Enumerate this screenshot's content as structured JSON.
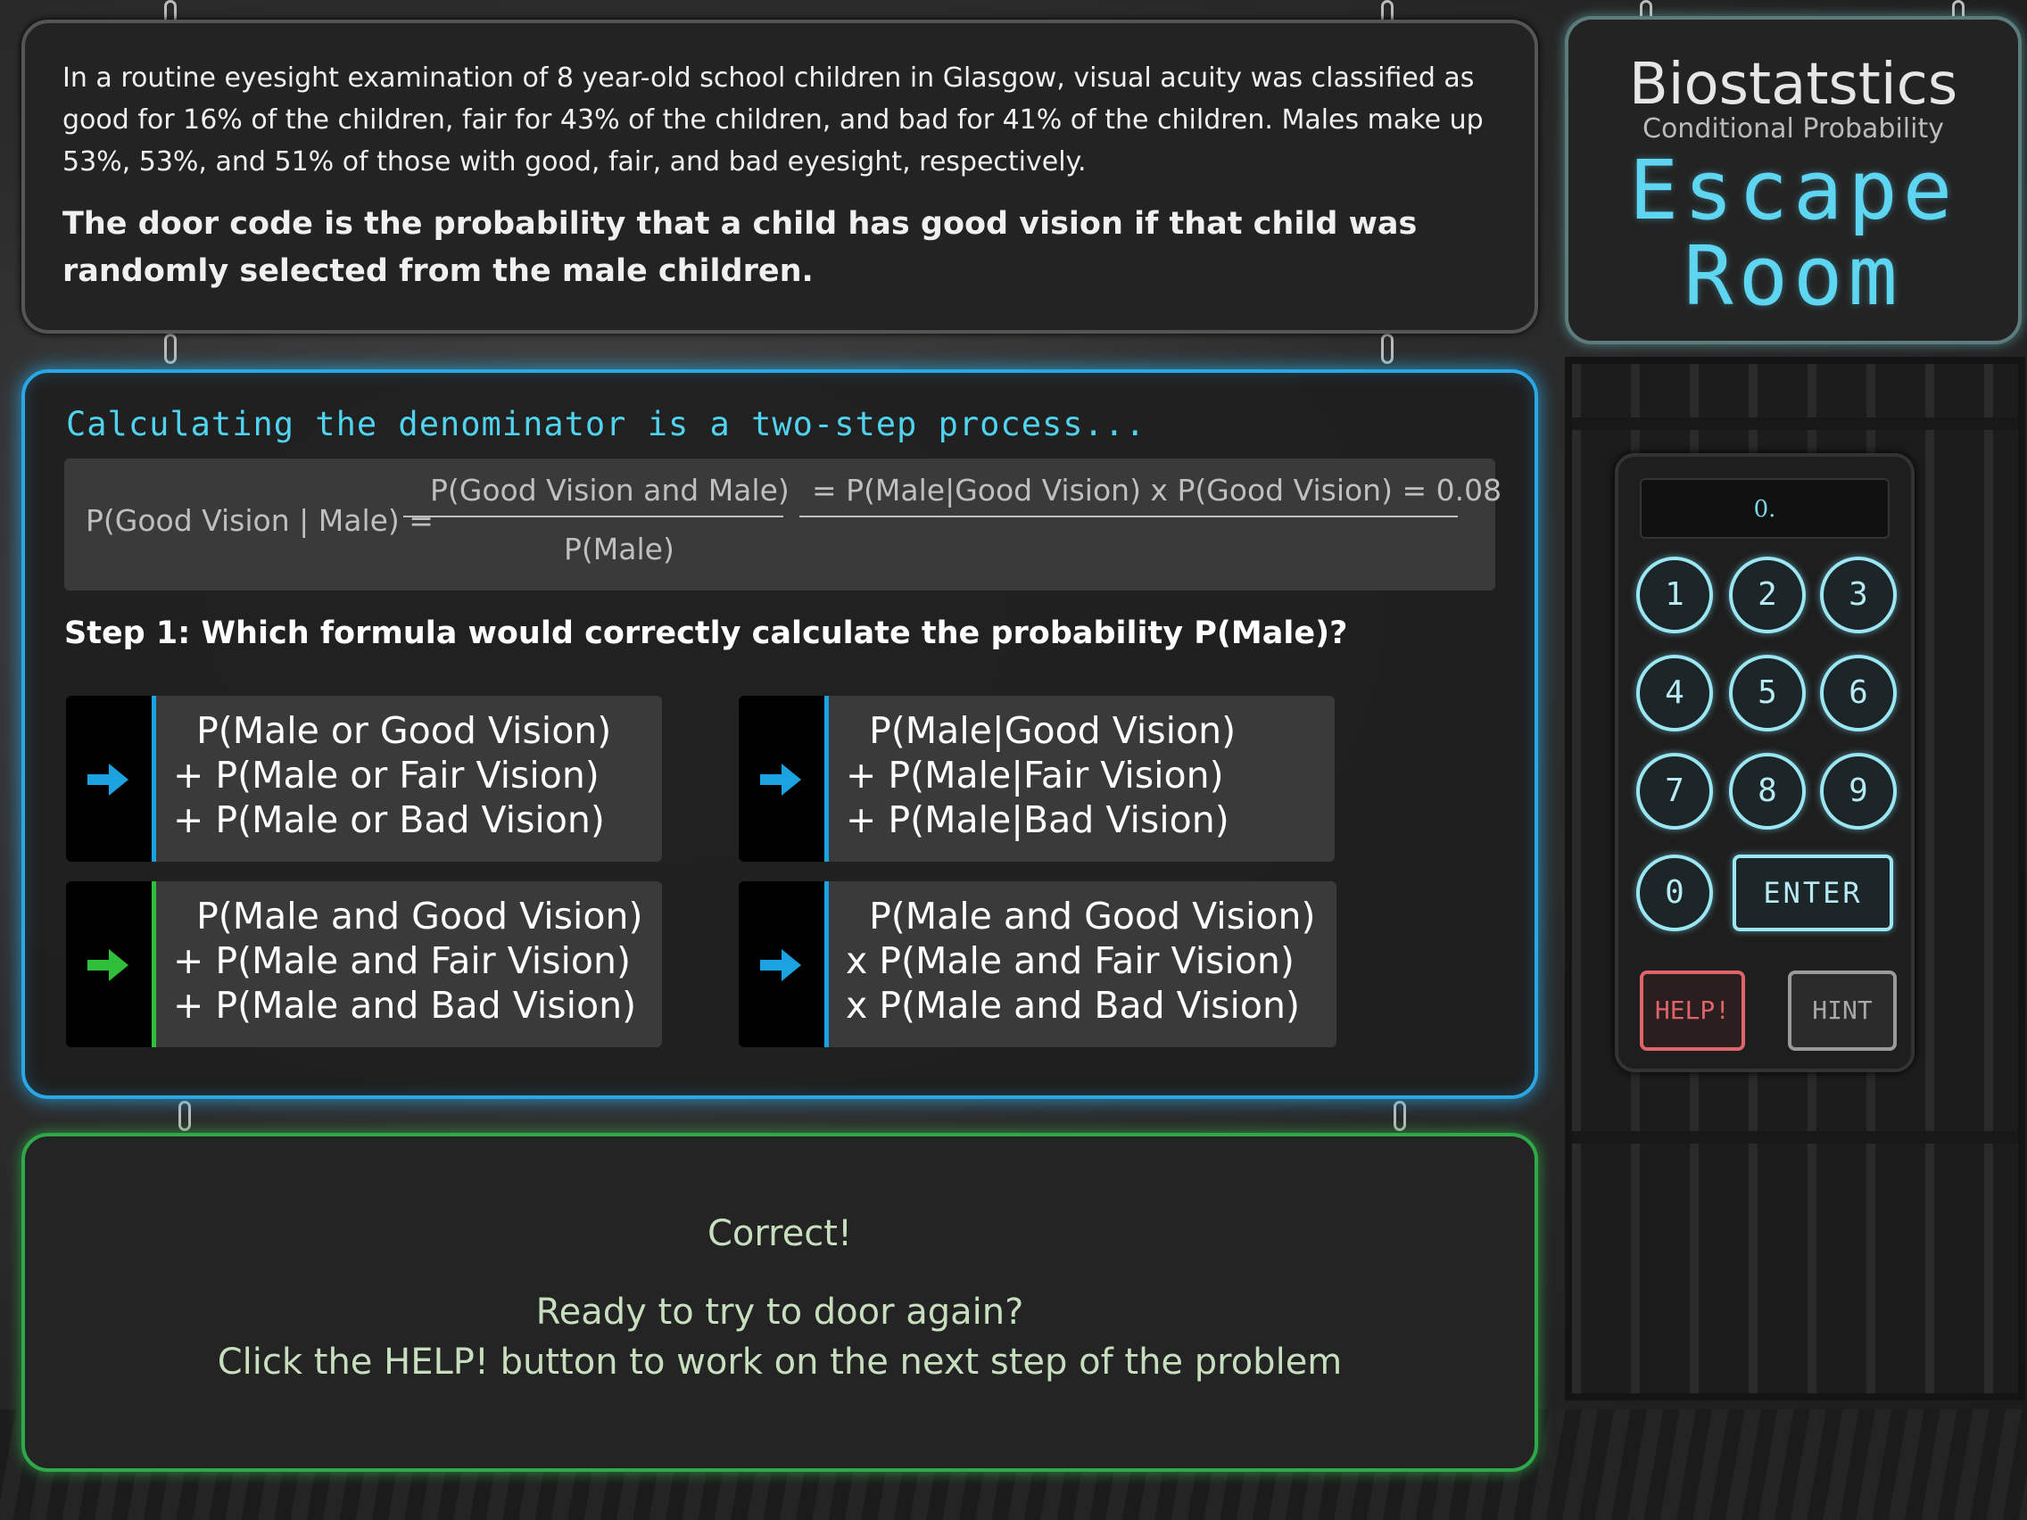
{
  "problem": {
    "text": "In a routine eyesight examination of 8 year-old school children in Glasgow, visual acuity was classified as good for 16% of the children, fair for 43% of the children, and bad for 41% of the children. Males make up 53%, 53%, and 51% of those with good, fair, and bad eyesight, respectively.",
    "question": "The door code is the probability that a child has good vision if that child was randomly selected from the male children."
  },
  "title": {
    "main": "Biostatstics",
    "sub": "Conditional Probability",
    "escape_line1": "Escape",
    "escape_line2": "Room"
  },
  "step": {
    "heading": "Calculating the denominator is a two-step process...",
    "formula": {
      "lhs": "P(Good Vision | Male) =",
      "numerator": "P(Good Vision and Male)",
      "denominator": "P(Male)",
      "rhs": "= P(Male|Good Vision) x P(Good Vision) = 0.08"
    },
    "question": "Step 1: Which formula would correctly calculate the probability P(Male)?",
    "options": [
      {
        "text": "  P(Male or Good Vision)\n+ P(Male or Fair Vision)\n+ P(Male or Bad Vision)",
        "arrow_color": "#1aa3e0"
      },
      {
        "text": "  P(Male|Good Vision)\n+ P(Male|Fair Vision)\n+ P(Male|Bad Vision)",
        "arrow_color": "#1aa3e0"
      },
      {
        "text": "  P(Male and Good Vision)\n+ P(Male and Fair Vision)\n+ P(Male and Bad Vision)",
        "arrow_color": "#2fbf3a"
      },
      {
        "text": "  P(Male and Good Vision)\nx P(Male and Fair Vision)\nx P(Male and Bad Vision)",
        "arrow_color": "#1aa3e0"
      }
    ]
  },
  "feedback": {
    "correct": "Correct!",
    "line1": "Ready to try to door again?",
    "line2": "Click the HELP! button to work on the next step of the problem"
  },
  "keypad": {
    "display": "0.",
    "keys": [
      "1",
      "2",
      "3",
      "4",
      "5",
      "6",
      "7",
      "8",
      "9",
      "0"
    ],
    "enter": "ENTER",
    "help": "HELP!",
    "hint": "HINT"
  },
  "colors": {
    "accent_blue": "#2aa8e6",
    "accent_green": "#2fa84a",
    "help_red": "#e0646a",
    "title_cyan": "#5ed6f2"
  }
}
